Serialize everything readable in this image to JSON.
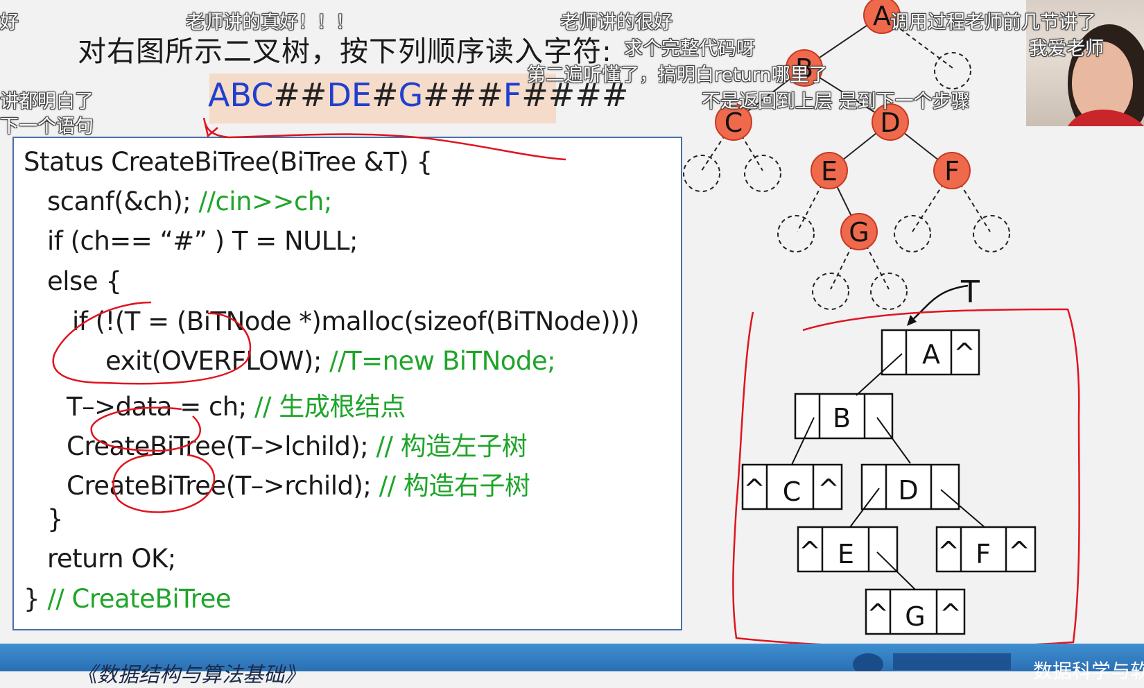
{
  "slide": {
    "title": "对右图所示二叉树，按下列顺序读入字符:",
    "sequence": [
      {
        "text": "ABC",
        "color": "blue"
      },
      {
        "text": "##",
        "color": "dark"
      },
      {
        "text": "DE",
        "color": "blue"
      },
      {
        "text": "#",
        "color": "dark"
      },
      {
        "text": "G",
        "color": "blue"
      },
      {
        "text": "###",
        "color": "dark"
      },
      {
        "text": "F",
        "color": "blue"
      },
      {
        "text": "####",
        "color": "dark"
      }
    ],
    "code": [
      {
        "code": "Status CreateBiTree(BiTree &T) {",
        "comment": ""
      },
      {
        "code": "scanf(&ch); ",
        "comment": "//cin>>ch;"
      },
      {
        "code": "if (ch== “#” )  T = NULL;",
        "comment": ""
      },
      {
        "code": "else {",
        "comment": ""
      },
      {
        "code": "if (!(T = (BiTNode *)malloc(sizeof(BiTNode))))",
        "comment": ""
      },
      {
        "code": "exit(OVERFLOW); ",
        "comment": "//T=new BiTNode;"
      },
      {
        "code": "T–>data = ch;    ",
        "comment": "// 生成根结点"
      },
      {
        "code": "CreateBiTree(T–>lchild);    ",
        "comment": "// 构造左子树"
      },
      {
        "code": "CreateBiTree(T–>rchild);   ",
        "comment": "// 构造右子树"
      },
      {
        "code": "}",
        "comment": ""
      },
      {
        "code": "return OK;",
        "comment": ""
      },
      {
        "code": "} ",
        "comment": "// CreateBiTree"
      }
    ],
    "tree_nodes": [
      "A",
      "B",
      "C",
      "D",
      "E",
      "F",
      "G"
    ],
    "pointer_label": "T",
    "null_symbol": "^",
    "footer_course": "《数据结构与算法基础》",
    "footer_dept": "数据科学与软"
  },
  "danmaku": [
    "老师讲的真好！！！",
    "老师讲的很好",
    "调用过程老师前几节讲了",
    "我爱老师",
    "求个完整代码呀",
    "第二遍听懂了，搞明白return哪里了",
    "不是返回到上层 是到下一个步骤",
    "讲都明白了",
    "下一个语句",
    "好"
  ],
  "colors": {
    "seq_blue": "#1f3fcf",
    "comment_green": "#1fa52a",
    "node_fill": "#ef6a4d",
    "annotation_red": "#e0141e",
    "code_border": "#4a6ea8",
    "footer_blue": "#2a6fb3"
  }
}
